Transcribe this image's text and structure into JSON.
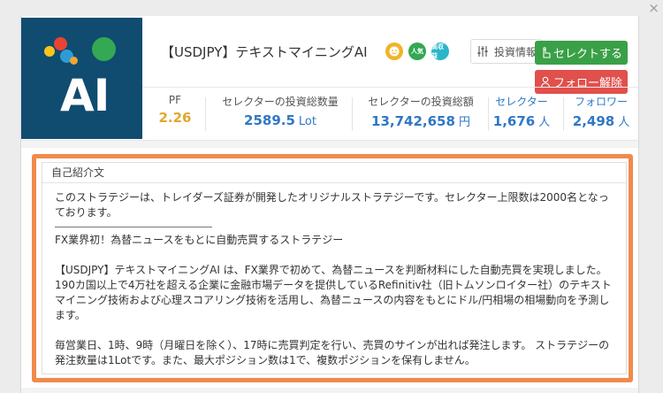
{
  "window": {
    "close_glyph": "×"
  },
  "logo": {
    "text": "AI",
    "dots": [
      "#e94335",
      "#f9c41c",
      "#2f9bd6",
      "#34a853",
      "#f0a733"
    ]
  },
  "strategy": {
    "title": "【USDJPY】テキストマイニングAI"
  },
  "badges": [
    {
      "text": "",
      "color": "#f0b429",
      "icon": "face-badge-icon"
    },
    {
      "text": "人気",
      "color": "#34a853",
      "icon": "popular-badge-icon"
    },
    {
      "text": "高収益",
      "color": "#2bb5c9",
      "icon": "high-profit-badge-icon"
    }
  ],
  "actions": {
    "invest_info": "投資情報",
    "select_button": "セレクトする",
    "unfollow_button": "フォロー解除"
  },
  "stats": {
    "pf_label": "PF",
    "pf_value": "2.26",
    "lot_label": "セレクターの投資総数量",
    "lot_value": "2589.5",
    "lot_unit": "Lot",
    "amount_label": "セレクターの投資総額",
    "amount_value": "13,742,658",
    "amount_unit": "円",
    "selector_label": "セレクター",
    "selector_value": "1,676",
    "selector_unit": "人",
    "follower_label": "フォロワー",
    "follower_value": "2,498",
    "follower_unit": "人"
  },
  "intro": {
    "heading": "自己紹介文",
    "p1": "このストラテジーは、トレイダーズ証券が開発したオリジナルストラテジーです。セレクター上限数は2000名となっております。",
    "p2": "FX業界初！為替ニュースをもとに自動売買するストラテジー",
    "p3": "【USDJPY】テキストマイニングAI は、FX業界で初めて、為替ニュースを判断材料にした自動売買を実現しました。190カ国以上で4万社を超える企業に金融市場データを提供しているRefinitiv社（旧トムソンロイター社）のテキストマイニング技術および心理スコアリング技術を活用し、為替ニュースの内容をもとにドル/円相場の相場動向を予測します。",
    "p4": "毎営業日、1時、9時（月曜日を除く）、17時に売買判定を行い、売買のサインが出れば発注します。 ストラテジーの発注数量は1Lotです。また、最大ポジション数は1で、複数ポジションを保有しません。"
  },
  "colors": {
    "logo_bg": "#0f4c70",
    "select_green": "#3aa047",
    "unfollow_red": "#e0504c",
    "highlight_orange": "#f08a4b",
    "value_blue": "#2f78c4",
    "pf_gold": "#e2a72e"
  }
}
